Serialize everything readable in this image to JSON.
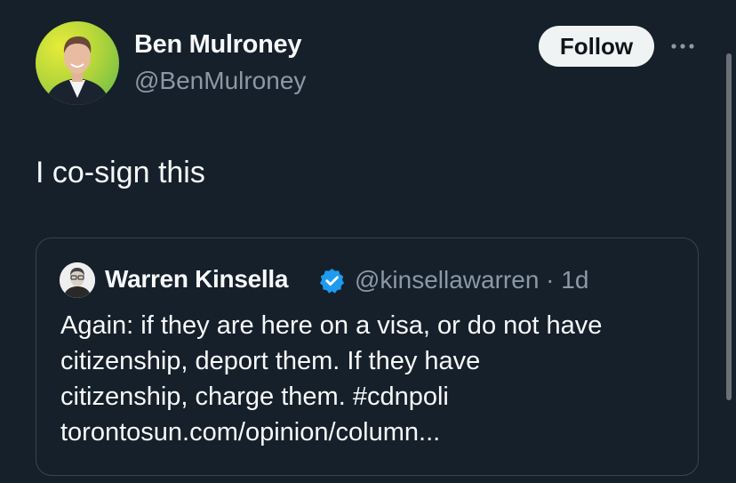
{
  "author": {
    "name": "Ben Mulroney",
    "handle": "@BenMulroney"
  },
  "actions": {
    "follow_label": "Follow",
    "more_icon": "ellipsis-icon"
  },
  "post": {
    "text": "I co-sign this"
  },
  "quote": {
    "name": "Warren Kinsella",
    "verified_icon": "verified-badge-icon",
    "handle_time": "@kinsellawarren · 1d",
    "body_lines": [
      "Again: if they are here on a visa, or do not have",
      "citizenship, deport them. If they have",
      "citizenship, charge them. #cdnpoli",
      "torontosun.com/opinion/column..."
    ]
  },
  "colors": {
    "background": "#15202b",
    "primary_text": "#f7f9f9",
    "secondary_text": "#8b98a5",
    "border": "#38444d",
    "verified": "#1d9bf0",
    "follow_bg": "#eff3f4"
  }
}
